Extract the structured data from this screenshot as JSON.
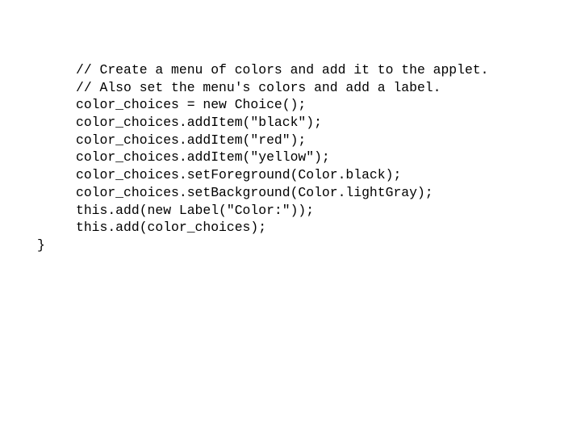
{
  "slide": {
    "background_color": "#ffffff",
    "text_color": "#000000",
    "font_style": "monospace"
  },
  "code": {
    "language": "java",
    "lines": [
      {
        "indent": 1,
        "text": "// Create a menu of colors and add it to the applet."
      },
      {
        "indent": 1,
        "text": "// Also set the menu's colors and add a label."
      },
      {
        "indent": 1,
        "text": "color_choices = new Choice();"
      },
      {
        "indent": 1,
        "text": "color_choices.addItem(\"black\");"
      },
      {
        "indent": 1,
        "text": "color_choices.addItem(\"red\");"
      },
      {
        "indent": 1,
        "text": "color_choices.addItem(\"yellow\");"
      },
      {
        "indent": 1,
        "text": "color_choices.setForeground(Color.black);"
      },
      {
        "indent": 1,
        "text": "color_choices.setBackground(Color.lightGray);"
      },
      {
        "indent": 1,
        "text": "this.add(new Label(\"Color:\"));"
      },
      {
        "indent": 1,
        "text": "this.add(color_choices);"
      },
      {
        "indent": 0,
        "text": "}"
      }
    ]
  }
}
